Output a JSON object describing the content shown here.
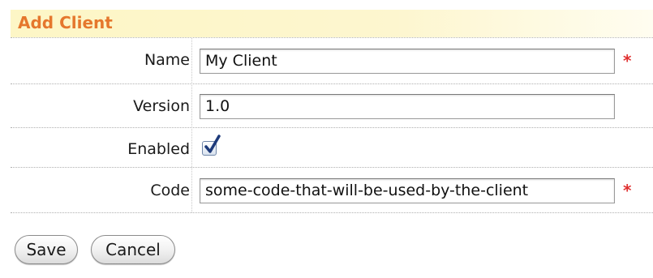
{
  "header": {
    "title": "Add Client"
  },
  "form": {
    "name": {
      "label": "Name",
      "value": "My Client",
      "required_mark": "*"
    },
    "version": {
      "label": "Version",
      "value": "1.0"
    },
    "enabled": {
      "label": "Enabled",
      "checked": true
    },
    "code": {
      "label": "Code",
      "value": "some-code-that-will-be-used-by-the-client",
      "required_mark": "*"
    }
  },
  "actions": {
    "save_label": "Save",
    "cancel_label": "Cancel"
  },
  "colors": {
    "title": "#e5772d",
    "required": "#e03030",
    "header_bg": "#fdf6c6"
  }
}
